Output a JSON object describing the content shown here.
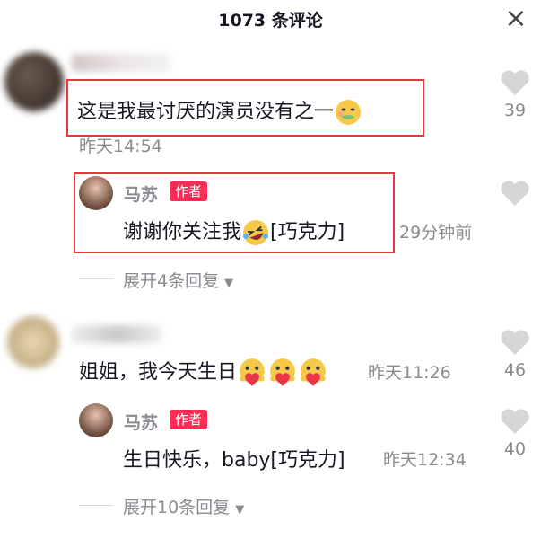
{
  "header": {
    "title": "1073 条评论",
    "close_icon": "close-icon"
  },
  "comments": [
    {
      "text": "这是我最讨厌的演员没有之一",
      "time": "昨天14:54",
      "likes": "39",
      "emoji": "nauseated-face-icon",
      "reply": {
        "name": "马苏",
        "badge": "作者",
        "text": "谢谢你关注我",
        "emoji": "rofl-face-icon",
        "suffix": "[巧克力]",
        "time": "29分钟前"
      },
      "expand": "展开4条回复"
    },
    {
      "text": "姐姐，我今天生日",
      "time": "昨天11:26",
      "likes": "46",
      "emoji": "heart-hug-face-icon",
      "reply": {
        "name": "马苏",
        "badge": "作者",
        "text": "生日快乐，baby[巧克力]",
        "time": "昨天12:34",
        "likes": "40"
      },
      "expand": "展开10条回复"
    }
  ],
  "colors": {
    "accent": "#fe2c55",
    "highlight_box": "#e33b3b",
    "muted": "#8a8b91"
  }
}
